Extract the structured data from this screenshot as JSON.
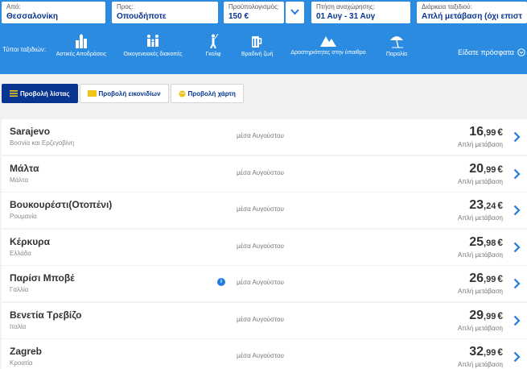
{
  "search": {
    "from": {
      "label": "Από:",
      "value": "Θεσσαλονίκη"
    },
    "to": {
      "label": "Προς:",
      "value": "Οπουδήποτε"
    },
    "budget": {
      "label": "Προϋπολογισμός:",
      "value": "150 €"
    },
    "dates": {
      "label": "Πτήση αναχώρησης:",
      "value": "01 Αυγ - 31 Αυγ"
    },
    "duration": {
      "label": "Διάρκεια ταξιδιού:",
      "value": "Απλή μετάβαση (όχι επιστρο"
    }
  },
  "trip_types_label": "Τύποι ταξιδιών:",
  "categories": [
    {
      "label": "Αστικές Αποδράσεις",
      "icon": "city-buildings-icon"
    },
    {
      "label": "Οικογενειακές διακοπές",
      "icon": "family-icon"
    },
    {
      "label": "Γκολφ",
      "icon": "golf-icon"
    },
    {
      "label": "Βραδινή ζωή",
      "icon": "nightlife-beer-icon"
    },
    {
      "label": "Δραστηριότητες στην ύπαιθρο",
      "icon": "mountain-icon"
    },
    {
      "label": "Παραλία",
      "icon": "beach-umbrella-icon"
    }
  ],
  "recent_label": "Είδατε πρόσφατα",
  "tabs": {
    "list": "Προβολή λίστας",
    "images": "Προβολή εικονιδίων",
    "map": "Προβολή χάρτη"
  },
  "colors": {
    "accent": "#2a8be0",
    "navy": "#073590",
    "chevron": "#1f7be0"
  },
  "results": [
    {
      "city": "Sarajevo",
      "country": "Βοσνία και Ερζεγοβίνη",
      "when": "μέσα Αυγούστου",
      "price_int": "16",
      "price_dec": ",99",
      "currency": "€",
      "type": "Απλή μετάβαση",
      "info": false
    },
    {
      "city": "Μάλτα",
      "country": "Μάλτα",
      "when": "μέσα Αυγούστου",
      "price_int": "20",
      "price_dec": ",99",
      "currency": "€",
      "type": "Απλή μετάβαση",
      "info": false
    },
    {
      "city": "Βουκουρέστι(Οτοπένι)",
      "country": "Ρουμανία",
      "when": "μέσα Αυγούστου",
      "price_int": "23",
      "price_dec": ",24",
      "currency": "€",
      "type": "Απλή μετάβαση",
      "info": false
    },
    {
      "city": "Κέρκυρα",
      "country": "Ελλάδα",
      "when": "μέσα Αυγούστου",
      "price_int": "25",
      "price_dec": ",98",
      "currency": "€",
      "type": "Απλή μετάβαση",
      "info": false
    },
    {
      "city": "Παρίσι Μποβέ",
      "country": "Γαλλία",
      "when": "μέσα Αυγούστου",
      "price_int": "26",
      "price_dec": ",99",
      "currency": "€",
      "type": "Απλή μετάβαση",
      "info": true
    },
    {
      "city": "Βενετία Τρεβίζο",
      "country": "Ιταλία",
      "when": "μέσα Αυγούστου",
      "price_int": "29",
      "price_dec": ",99",
      "currency": "€",
      "type": "Απλή μετάβαση",
      "info": false
    },
    {
      "city": "Zagreb",
      "country": "Κροατία",
      "when": "μέσα Αυγούστου",
      "price_int": "32",
      "price_dec": ",99",
      "currency": "€",
      "type": "Απλή μετάβαση",
      "info": false
    }
  ]
}
